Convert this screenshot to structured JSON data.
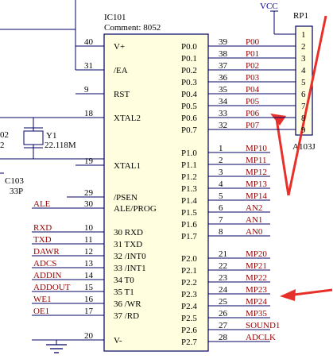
{
  "colors": {
    "wire": "#000066",
    "net_label": "#990000",
    "text": "#000000",
    "vcc": "#000099",
    "arrow": "#e8302a",
    "chip_fill": "#ffffe0"
  },
  "chip": {
    "ref": "IC101",
    "comment": "Comment: 8052",
    "left_pins": [
      {
        "num": "40",
        "name": "V+",
        "net": ""
      },
      {
        "num": "31",
        "name": "/EA",
        "net": ""
      },
      {
        "num": "9",
        "name": "RST",
        "net": ""
      },
      {
        "num": "18",
        "name": "XTAL2",
        "net": ""
      },
      {
        "num": "19",
        "name": "XTAL1",
        "net": ""
      },
      {
        "num": "29",
        "name": "/PSEN",
        "net": ""
      },
      {
        "num": "30",
        "name": "ALE/PROG",
        "net": "ALE"
      },
      {
        "num": "10",
        "name": "30 RXD",
        "net": "RXD"
      },
      {
        "num": "11",
        "name": "31 TXD",
        "net": "TXD"
      },
      {
        "num": "12",
        "name": "32 /INT0",
        "net": "DAWR"
      },
      {
        "num": "13",
        "name": "33 /INT1",
        "net": "ADCS"
      },
      {
        "num": "14",
        "name": "34 T0",
        "net": "ADDIN"
      },
      {
        "num": "15",
        "name": "35 T1",
        "net": "ADDOUT"
      },
      {
        "num": "16",
        "name": "36 /WR",
        "net": "WE1"
      },
      {
        "num": "17",
        "name": "37 /RD",
        "net": "OE1"
      },
      {
        "num": "20",
        "name": "V-",
        "net": ""
      }
    ],
    "right_pins": [
      {
        "num": "39",
        "name": "P0.0",
        "net": "P00"
      },
      {
        "num": "38",
        "name": "P0.1",
        "net": "P01"
      },
      {
        "num": "37",
        "name": "P0.2",
        "net": "P02"
      },
      {
        "num": "36",
        "name": "P0.3",
        "net": "P03"
      },
      {
        "num": "35",
        "name": "P0.4",
        "net": "P04"
      },
      {
        "num": "34",
        "name": "P0.5",
        "net": "P05"
      },
      {
        "num": "33",
        "name": "P0.6",
        "net": "P06"
      },
      {
        "num": "32",
        "name": "P0.7",
        "net": "P07"
      },
      {
        "num": "1",
        "name": "P1.0",
        "net": "MP10"
      },
      {
        "num": "2",
        "name": "P1.1",
        "net": "MP11"
      },
      {
        "num": "3",
        "name": "P1.2",
        "net": "MP12"
      },
      {
        "num": "4",
        "name": "P1.3",
        "net": "MP13"
      },
      {
        "num": "5",
        "name": "P1.4",
        "net": "MP14"
      },
      {
        "num": "6",
        "name": "P1.5",
        "net": "AN2"
      },
      {
        "num": "7",
        "name": "P1.6",
        "net": "AN1"
      },
      {
        "num": "8",
        "name": "P1.7",
        "net": "AN0"
      },
      {
        "num": "21",
        "name": "P2.0",
        "net": "MP20"
      },
      {
        "num": "22",
        "name": "P2.1",
        "net": "MP21"
      },
      {
        "num": "23",
        "name": "P2.2",
        "net": "MP22"
      },
      {
        "num": "24",
        "name": "P2.3",
        "net": "MP23"
      },
      {
        "num": "25",
        "name": "P2.4",
        "net": "MP24"
      },
      {
        "num": "26",
        "name": "P2.5",
        "net": "MP35"
      },
      {
        "num": "27",
        "name": "P2.6",
        "net": "SOUND1"
      },
      {
        "num": "28",
        "name": "P2.7",
        "net": "ADCLK"
      }
    ]
  },
  "vcc_label": "VCC",
  "rpack": {
    "ref": "RP1",
    "value": "A103J",
    "pins": [
      "1",
      "2",
      "3",
      "4",
      "5",
      "6",
      "7",
      "8",
      "9"
    ]
  },
  "crystal": {
    "ref": "Y1",
    "value": "22.118M",
    "fragment": "02"
  },
  "cap": {
    "ref": "C103",
    "value": "33P"
  },
  "fragment_left_2": "2"
}
